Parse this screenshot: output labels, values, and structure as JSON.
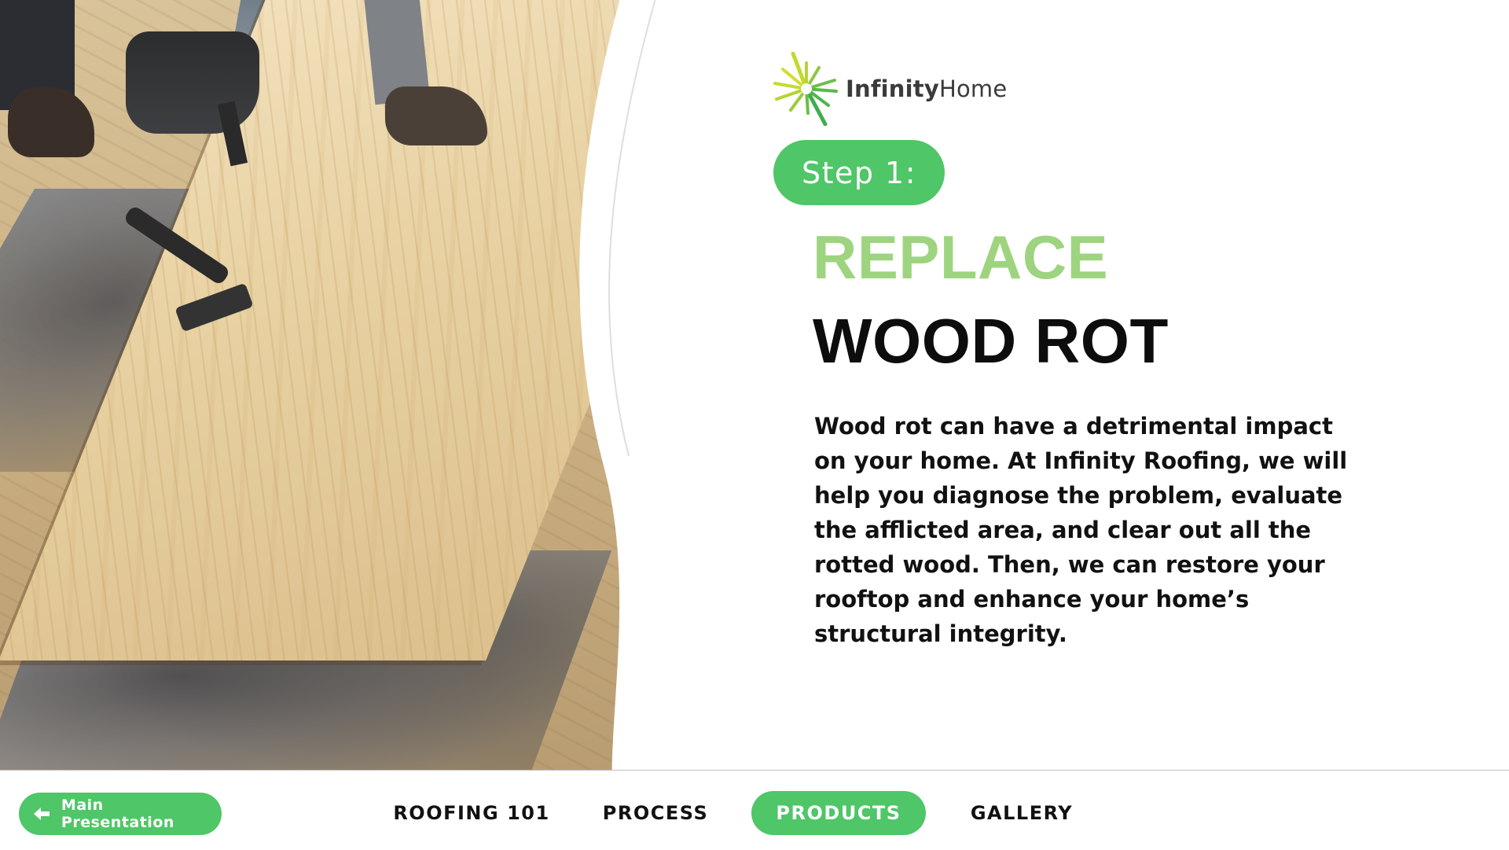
{
  "brand": {
    "logo_text_bold": "Infinity",
    "logo_text_light": "Home",
    "accent_color": "#4fc667",
    "title_green": "#9ed47f"
  },
  "slide": {
    "step_label": "Step 1:",
    "title_line1": "REPLACE",
    "title_line2": "WOOD ROT",
    "body": "Wood rot can have a detrimental impact on your home. At Infinity Roofing, we will help you diagnose the problem, evaluate the afflicted area, and clear out all the rotted wood. Then, we can restore your rooftop and enhance your home’s structural integrity.",
    "photo_icon": "roof-deck-repair-photo"
  },
  "nav": {
    "back_label": "Main Presentation",
    "back_icon": "arrow-left-icon",
    "items": [
      {
        "label": "ROOFING 101",
        "active": false
      },
      {
        "label": "PROCESS",
        "active": false
      },
      {
        "label": "PRODUCTS",
        "active": true
      },
      {
        "label": "GALLERY",
        "active": false
      }
    ]
  }
}
